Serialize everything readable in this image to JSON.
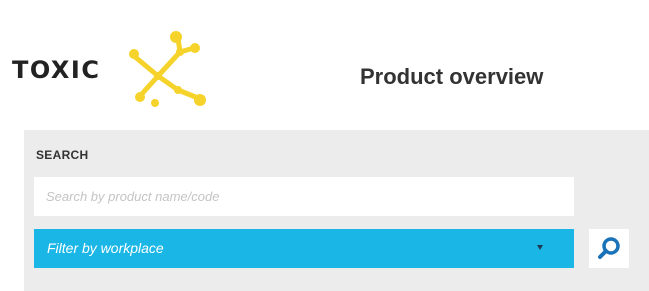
{
  "header": {
    "logo_text": "TOXIC",
    "title": "Product overview"
  },
  "search": {
    "heading": "SEARCH",
    "input_placeholder": "Search by product name/code",
    "input_value": "",
    "filter_label": "Filter by workplace",
    "button_icon": "search-icon"
  },
  "colors": {
    "brand_yellow": "#f5d32a",
    "filter_blue": "#19b6e6",
    "panel_gray": "#ececec",
    "search_icon_blue": "#1a73b8"
  }
}
